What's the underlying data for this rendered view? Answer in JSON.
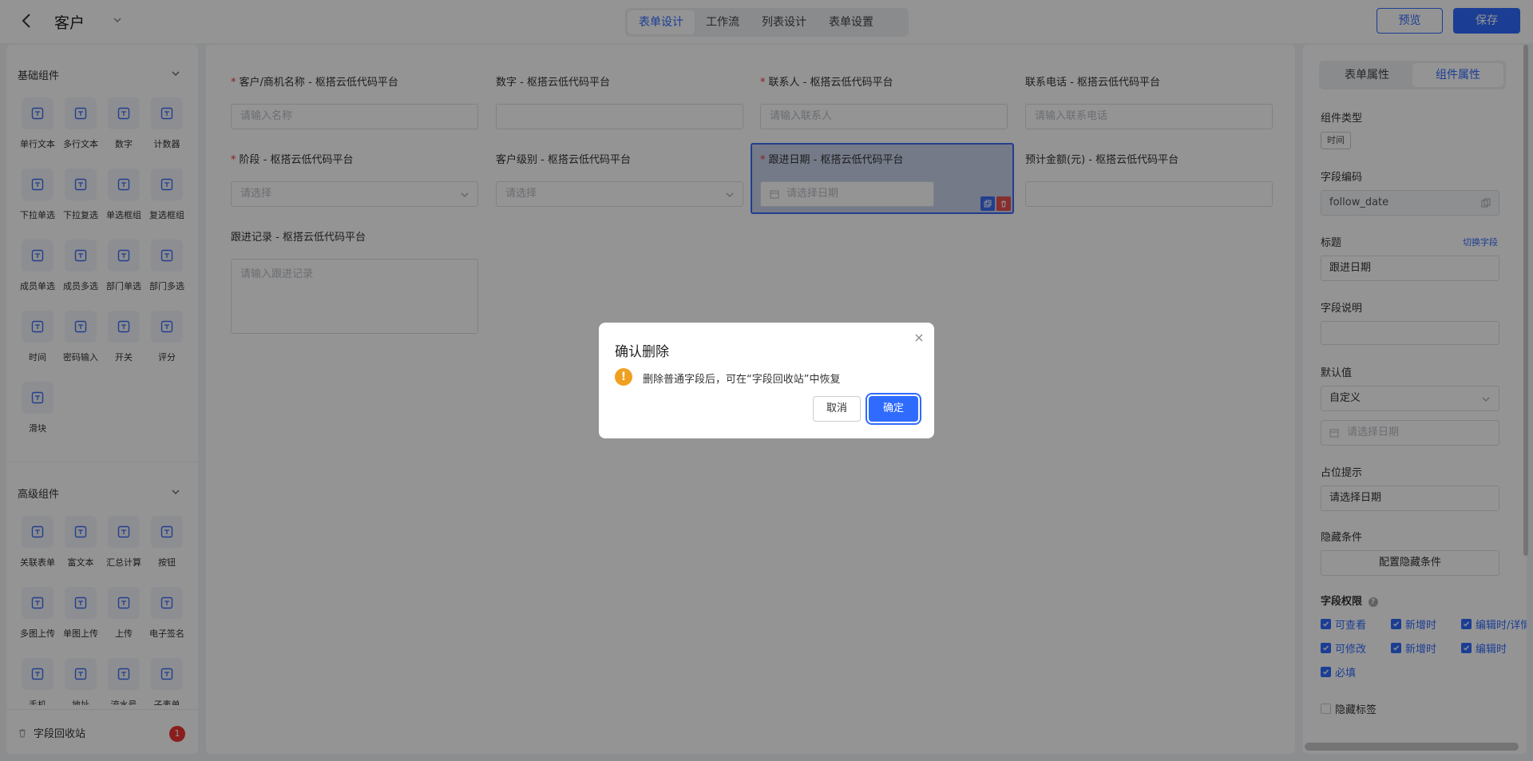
{
  "header": {
    "title": "客户",
    "tabs": [
      {
        "label": "表单设计",
        "active": true
      },
      {
        "label": "工作流",
        "active": false
      },
      {
        "label": "列表设计",
        "active": false
      },
      {
        "label": "表单设置",
        "active": false
      }
    ],
    "preview_label": "预览",
    "save_label": "保存"
  },
  "left_panel": {
    "basic_title": "基础组件",
    "basic_items": [
      "单行文本",
      "多行文本",
      "数字",
      "计数器",
      "下拉单选",
      "下拉复选",
      "单选框组",
      "复选框组",
      "成员单选",
      "成员多选",
      "部门单选",
      "部门多选",
      "时间",
      "密码输入",
      "开关",
      "评分",
      "滑块"
    ],
    "advanced_title": "高级组件",
    "advanced_items": [
      "关联表单",
      "富文本",
      "汇总计算",
      "按钮",
      "多图上传",
      "单图上传",
      "上传",
      "电子签名",
      "手机",
      "地址",
      "流水号",
      "子表单"
    ],
    "recycle_label": "字段回收站",
    "recycle_count": "1"
  },
  "form": {
    "fields": [
      {
        "label": "客户/商机名称  - 枢搭云低代码平台",
        "required": true,
        "placeholder": "请输入名称",
        "kind": "text"
      },
      {
        "label": "数字  - 枢搭云低代码平台",
        "required": false,
        "placeholder": "",
        "kind": "text"
      },
      {
        "label": "联系人  - 枢搭云低代码平台",
        "required": true,
        "placeholder": "请输入联系人",
        "kind": "text"
      },
      {
        "label": "联系电话  - 枢搭云低代码平台",
        "required": false,
        "placeholder": "请输入联系电话",
        "kind": "text"
      },
      {
        "label": "阶段  - 枢搭云低代码平台",
        "required": true,
        "placeholder": "请选择",
        "kind": "select"
      },
      {
        "label": "客户级别  - 枢搭云低代码平台",
        "required": false,
        "placeholder": "请选择",
        "kind": "select"
      },
      {
        "label": "跟进日期  - 枢搭云低代码平台",
        "required": true,
        "placeholder": "请选择日期",
        "kind": "date"
      },
      {
        "label": "预计金额(元)  - 枢搭云低代码平台",
        "required": false,
        "placeholder": "",
        "kind": "text"
      },
      {
        "label": "跟进记录  - 枢搭云低代码平台",
        "required": false,
        "placeholder": "请输入跟进记录",
        "kind": "textarea"
      }
    ]
  },
  "right_panel": {
    "tabs": [
      {
        "label": "表单属性",
        "active": false
      },
      {
        "label": "组件属性",
        "active": true
      }
    ],
    "component_type_label": "组件类型",
    "component_type_value": "时间",
    "field_code_label": "字段编码",
    "field_code_value": "follow_date",
    "title_label": "标题",
    "switch_field_label": "切换字段",
    "title_value": "跟进日期",
    "description_label": "字段说明",
    "default_label": "默认值",
    "default_mode": "自定义",
    "default_date_placeholder": "请选择日期",
    "placeholder_label": "占位提示",
    "placeholder_value": "请选择日期",
    "hide_cond_label": "隐藏条件",
    "hide_cond_button": "配置隐藏条件",
    "perm_label": "字段权限",
    "perm_rows": [
      [
        "可查看",
        "新增时",
        "编辑时/详情时"
      ],
      [
        "可修改",
        "新增时",
        "编辑时"
      ],
      [
        "必填"
      ]
    ],
    "hide_label_text": "隐藏标签"
  },
  "dialog": {
    "title": "确认删除",
    "message": "删除普通字段后，可在“字段回收站”中恢复",
    "cancel_label": "取消",
    "ok_label": "确定"
  },
  "colors": {
    "accent": "#2f6bff",
    "danger": "#e33333",
    "warning": "#f0a020"
  }
}
